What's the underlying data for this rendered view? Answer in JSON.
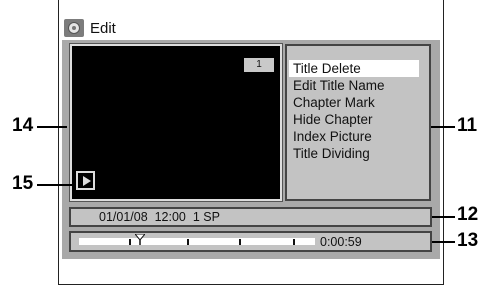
{
  "header": {
    "title": "Edit",
    "icon": "disc-icon"
  },
  "preview": {
    "title_number": "1",
    "play_icon": "play-icon"
  },
  "menu": {
    "items": [
      {
        "label": "Title Delete",
        "selected": true
      },
      {
        "label": "Edit Title Name",
        "selected": false
      },
      {
        "label": "Chapter Mark",
        "selected": false
      },
      {
        "label": "Hide Chapter",
        "selected": false
      },
      {
        "label": "Index Picture",
        "selected": false
      },
      {
        "label": "Title Dividing",
        "selected": false
      }
    ]
  },
  "info": {
    "text": "01/01/08  12:00  1 SP"
  },
  "timeline": {
    "time": "0:00:59"
  },
  "callouts": {
    "c14": "14",
    "c15": "15",
    "c11": "11",
    "c12": "12",
    "c13": "13"
  },
  "colors": {
    "panel_gray": "#a9a9a9",
    "menu_gray": "#c3c3c3",
    "selected": "#ffffff"
  }
}
